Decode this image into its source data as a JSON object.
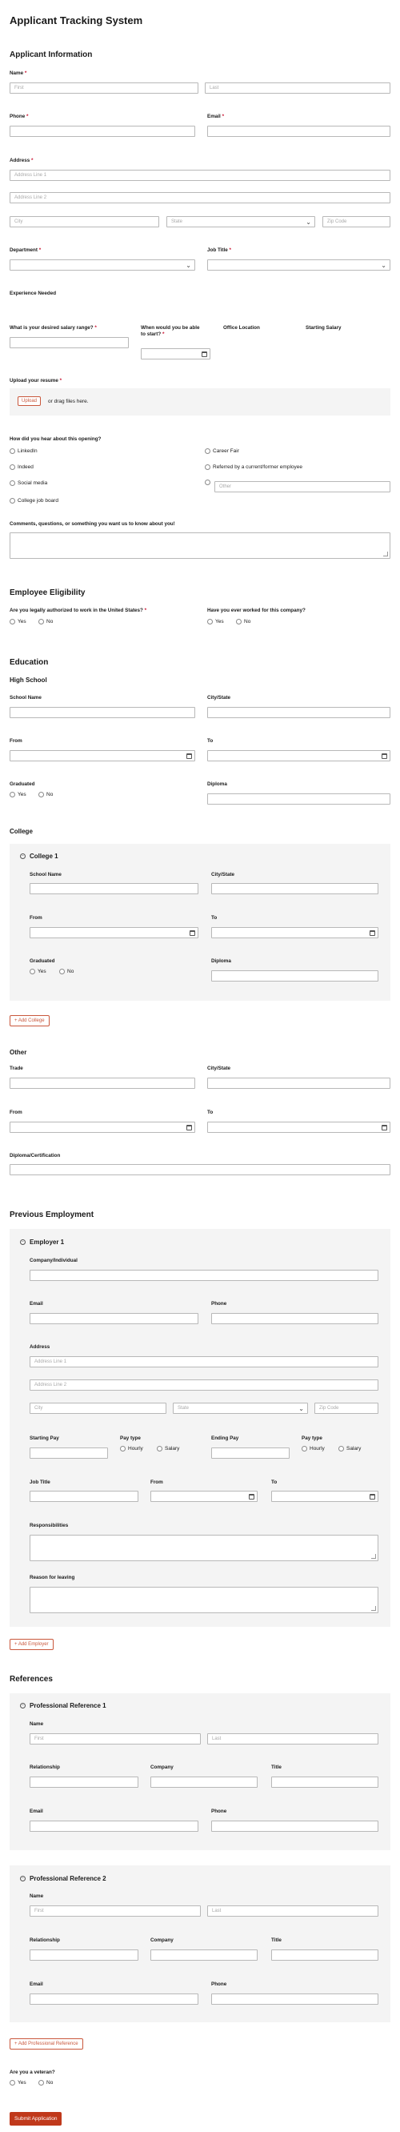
{
  "title": "Applicant Tracking System",
  "sections": {
    "applicant": "Applicant Information",
    "eligibility": "Employee Eligibility",
    "education": "Education",
    "employment": "Previous Employment",
    "references": "References"
  },
  "labels": {
    "name": "Name",
    "phone": "Phone",
    "email": "Email",
    "address": "Address",
    "department": "Department",
    "job_title": "Job Title",
    "experience": "Experience Needed",
    "salary": "What is your desired salary range?",
    "start": "When would you be able to start?",
    "office": "Office Location",
    "starting_salary": "Starting Salary",
    "resume": "Upload your resume",
    "hear": "How did you hear about this opening?",
    "comments": "Comments, questions, or something you want us to know about you!",
    "authorized": "Are you legally authorized to work in the United States?",
    "worked": "Have you ever worked for this company?",
    "high_school": "High School",
    "school_name": "School Name",
    "city_state": "City/State",
    "from": "From",
    "to": "To",
    "graduated": "Graduated",
    "diploma": "Diploma",
    "college": "College",
    "college1": "College 1",
    "other": "Other",
    "trade": "Trade",
    "diploma_cert": "Diploma/Certification",
    "employer1": "Employer 1",
    "company_individual": "Company/Individual",
    "starting_pay": "Starting Pay",
    "pay_type": "Pay type",
    "ending_pay": "Ending Pay",
    "responsibilities": "Responsibilities",
    "reason": "Reason for leaving",
    "ref1": "Professional Reference 1",
    "ref2": "Professional Reference 2",
    "relationship": "Relationship",
    "company": "Company",
    "title": "Title",
    "veteran": "Are you a veteran?"
  },
  "placeholders": {
    "first": "First",
    "last": "Last",
    "addr1": "Address Line 1",
    "addr2": "Address Line 2",
    "city": "City",
    "state": "State",
    "zip": "Zip Code",
    "other": "Other"
  },
  "upload": {
    "button": "Upload",
    "text": "or drag files here."
  },
  "hear_options": {
    "linkedin": "LinkedIn",
    "indeed": "Indeed",
    "social": "Social media",
    "college": "College job board",
    "career": "Career Fair",
    "referred": "Referred by a current/former employee"
  },
  "yesno": {
    "yes": "Yes",
    "no": "No"
  },
  "pay": {
    "hourly": "Hourly",
    "salary": "Salary"
  },
  "buttons": {
    "add_college": "Add College",
    "add_employer": "Add Employer",
    "add_reference": "Add Professional Reference",
    "submit": "Submit Application"
  },
  "colors": {
    "accent": "#c9573c",
    "submit": "#c0391b",
    "panel": "#f4f4f4"
  }
}
